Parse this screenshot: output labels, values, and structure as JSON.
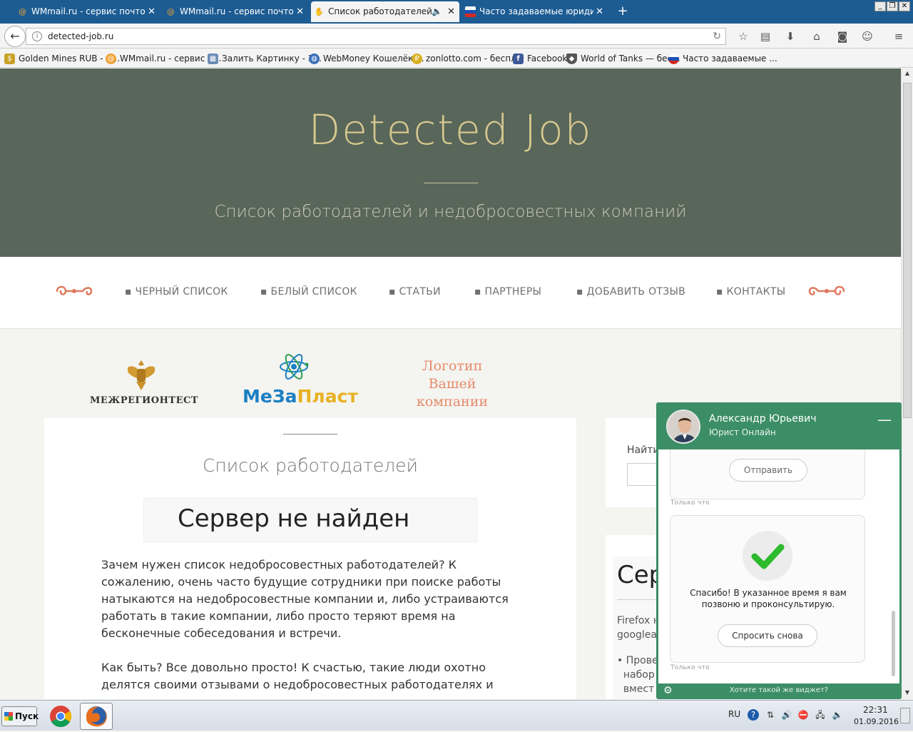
{
  "browser": {
    "tabs": [
      {
        "label": "WMmail.ru - сервис почтовы...",
        "icon": "at-icon",
        "active": false
      },
      {
        "label": "WMmail.ru - сервис почтовы...",
        "icon": "at-icon",
        "active": false
      },
      {
        "label": "Список работодателей",
        "icon": "hand-icon",
        "active": true
      },
      {
        "label": "Часто задаваемые юридич...",
        "icon": "russia-flag-icon",
        "active": false
      }
    ],
    "url": "detected-job.ru",
    "bookmarks": [
      {
        "label": "Golden Mines RUB - A...",
        "icon": "coin-icon",
        "color": "#c9a227"
      },
      {
        "label": "WMmail.ru - сервис п...",
        "icon": "at-icon",
        "color": "#f0a030"
      },
      {
        "label": "Залить Картинку - З...",
        "icon": "image-icon",
        "color": "#6a8ab5"
      },
      {
        "label": "WebMoney Кошелёк ...",
        "icon": "globe-icon",
        "color": "#3a6fb8"
      },
      {
        "label": "zonlotto.com - беспл...",
        "icon": "coin-icon",
        "color": "#d8b020"
      },
      {
        "label": "Facebook",
        "icon": "facebook-icon",
        "color": "#3b5998"
      },
      {
        "label": "World of Tanks — бес...",
        "icon": "shield-icon",
        "color": "#555555"
      },
      {
        "label": "Часто задаваемые ...",
        "icon": "russia-flag-icon",
        "color": "#cc2222"
      }
    ]
  },
  "site": {
    "title": "Detected Job",
    "subtitle": "Список работодателей и недобросовестных компаний",
    "menu": [
      "ЧЕРНЫЙ СПИСОК",
      "БЕЛЫЙ СПИСОК",
      "СТАТЬИ",
      "ПАРТНЕРЫ",
      "ДОБАВИТЬ ОТЗЫВ",
      "КОНТАКТЫ"
    ],
    "partners": {
      "logo1": "МЕЖРЕГИОНТЕСТ",
      "logo2_part1": "МеЗа",
      "logo2_part2": "Пласт",
      "logo3": "Логотип Вашей компании"
    },
    "content": {
      "title": "Список работодателей",
      "iframe_error": "Сервер не найден",
      "paragraph1": "Зачем нужен список недобросовестных работодателей? К сожалению, очень часто будущие сотрудники при поиске работы натыкаются на недобросовестные компании и, либо устраиваются работать в такие компании, либо просто теряют время на бесконечные собеседования и встречи.",
      "paragraph2": "Как быть? Все довольно просто! К счастью, такие люди охотно делятся своими отзывами о недобросовестных работодателях и предостерегают"
    },
    "sidebar": {
      "search_label": "Найти",
      "frame_title": "Сер",
      "frame_line1": "Firefox н",
      "frame_line2": "googleac",
      "frame_bullet1": "Прове",
      "frame_bullet2": "набор",
      "frame_bullet3": "вмест"
    }
  },
  "chat": {
    "agent_name": "Александр Юрьевич",
    "agent_role": "Юрист Онлайн",
    "send_label": "Отправить",
    "timestamp1": "Только что",
    "thanks_text": "Спасибо! В указанное время я вам позвоню и проконсультирую.",
    "ask_again_label": "Спросить снова",
    "timestamp2": "Только что",
    "footer_promo": "Хотите такой же виджет?"
  },
  "taskbar": {
    "start_label": "Пуск",
    "lang": "RU",
    "time": "22:31",
    "date": "01.09.2016"
  },
  "colors": {
    "hero_bg": "#59665a",
    "title_gold": "#d7c98f",
    "accent_orange": "#e88a6a",
    "chat_green": "#3c8e67",
    "tab_bar": "#1d5c93"
  }
}
